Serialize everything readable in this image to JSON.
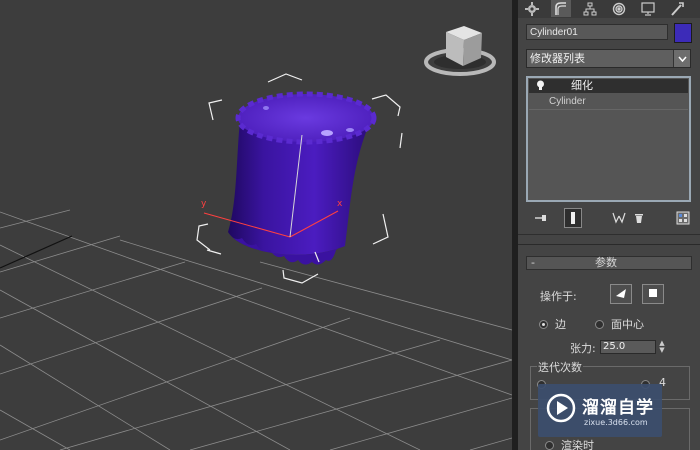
{
  "app": {
    "accent": "#4a1fa8",
    "swatch_color": "#3c2bb8"
  },
  "viewport": {
    "object_color": "#4312a8",
    "grid_color": "#8a8a8a",
    "axis_x_label": "x",
    "axis_y_label": "y",
    "viewcube_icon": "viewcube-icon"
  },
  "command_panel": {
    "tabs": [
      "create-icon",
      "modify-icon",
      "hierarchy-icon",
      "motion-icon",
      "display-icon",
      "utilities-icon"
    ],
    "object_name": "Cylinder01",
    "modifier_list": "修改器列表",
    "stack_items": [
      {
        "label": "细化",
        "icon": "lightbulb-icon",
        "selected": true
      },
      {
        "label": "Cylinder",
        "selected": false
      }
    ],
    "stack_tools": [
      "pin-stack-icon",
      "show-end-result-icon",
      "make-unique-icon",
      "remove-modifier-icon",
      "configure-modifier-sets-icon"
    ]
  },
  "parameters": {
    "collapse": "-",
    "title": "参数",
    "operate_on_label": "操作于:",
    "radio_edge": "边",
    "radio_face_center": "面中心",
    "tension_label": "张力:",
    "tension_value": "25.0",
    "iterations_label": "迭代次数",
    "iteration_last": "4",
    "update_label": "渲染时"
  },
  "watermark": {
    "brand": "溜溜自学",
    "url": "zixue.3d66.com"
  }
}
